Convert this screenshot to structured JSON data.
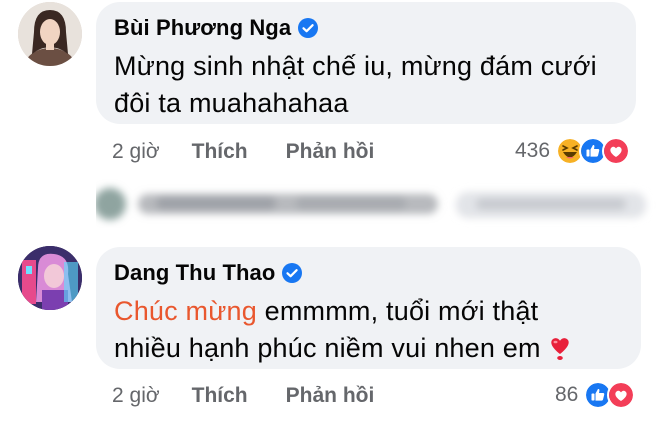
{
  "comments": [
    {
      "author": "Bùi Phương Nga",
      "verified": true,
      "text_line1": "Mừng sinh nhật chế iu, mừng đám cưới",
      "text_line2": "đôi ta muahahahaa",
      "time": "2 giờ",
      "like_label": "Thích",
      "reply_label": "Phản hồi",
      "reaction_count": "436",
      "reactions": [
        "haha-icon",
        "like-icon",
        "love-icon"
      ]
    },
    {
      "author": "Dang Thu Thao",
      "verified": true,
      "text_highlight": "Chúc mừng",
      "text_line1_rest": " emmmm, tuổi mới thật",
      "text_line2": "nhiều hạnh phúc niềm vui nhen em",
      "text_emoji": "heart-icon",
      "time": "2 giờ",
      "like_label": "Thích",
      "reply_label": "Phản hồi",
      "reaction_count": "86",
      "reactions": [
        "like-icon",
        "love-icon"
      ]
    }
  ],
  "colors": {
    "bubble_bg": "#f0f2f5",
    "meta_text": "#65676b",
    "highlight": "#e9572e",
    "verified_blue": "#1877f2",
    "like_blue": "#1877f2",
    "love_red": "#f33e58",
    "haha_yellow": "#f7b125"
  }
}
